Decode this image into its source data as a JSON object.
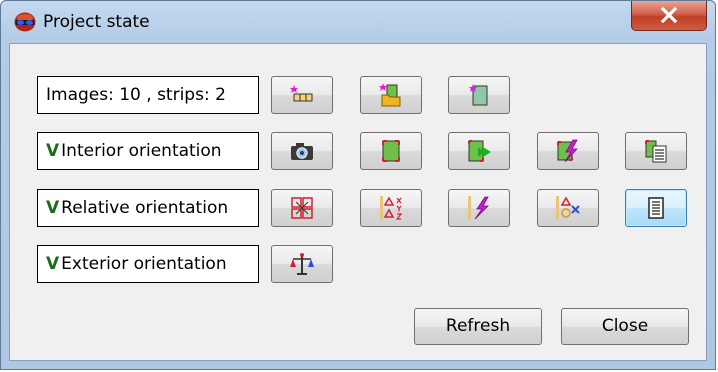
{
  "window": {
    "title": "Project state",
    "app_icon": "red-blue-glasses-icon",
    "close_icon": "close-x-icon"
  },
  "rows": [
    {
      "label": "Images: 10 , strips: 2",
      "check": "",
      "buttons": [
        {
          "icon": "add-strip-icon"
        },
        {
          "icon": "add-images-from-folder-icon"
        },
        {
          "icon": "add-image-icon"
        }
      ]
    },
    {
      "label": "Interior orientation",
      "check": "V",
      "buttons": [
        {
          "icon": "camera-icon"
        },
        {
          "icon": "fiducial-marks-icon"
        },
        {
          "icon": "batch-measure-icon"
        },
        {
          "icon": "compute-orientation-icon"
        },
        {
          "icon": "report-icon"
        }
      ]
    },
    {
      "label": "Relative orientation",
      "check": "V",
      "buttons": [
        {
          "icon": "tie-points-icon"
        },
        {
          "icon": "point-coordinates-icon"
        },
        {
          "icon": "adjust-icon"
        },
        {
          "icon": "remove-points-icon"
        },
        {
          "icon": "report-icon",
          "active": true
        }
      ]
    },
    {
      "label": "Exterior orientation",
      "check": "V",
      "buttons": [
        {
          "icon": "scale-balance-icon"
        }
      ]
    }
  ],
  "footer": {
    "refresh_label": "Refresh",
    "close_label": "Close"
  },
  "colors": {
    "titlebar": "#b9d1ea",
    "client": "#f0f0f0",
    "close_button": "#c74a32",
    "check": "#1e6b1e",
    "active_button": "#bee6fd"
  }
}
